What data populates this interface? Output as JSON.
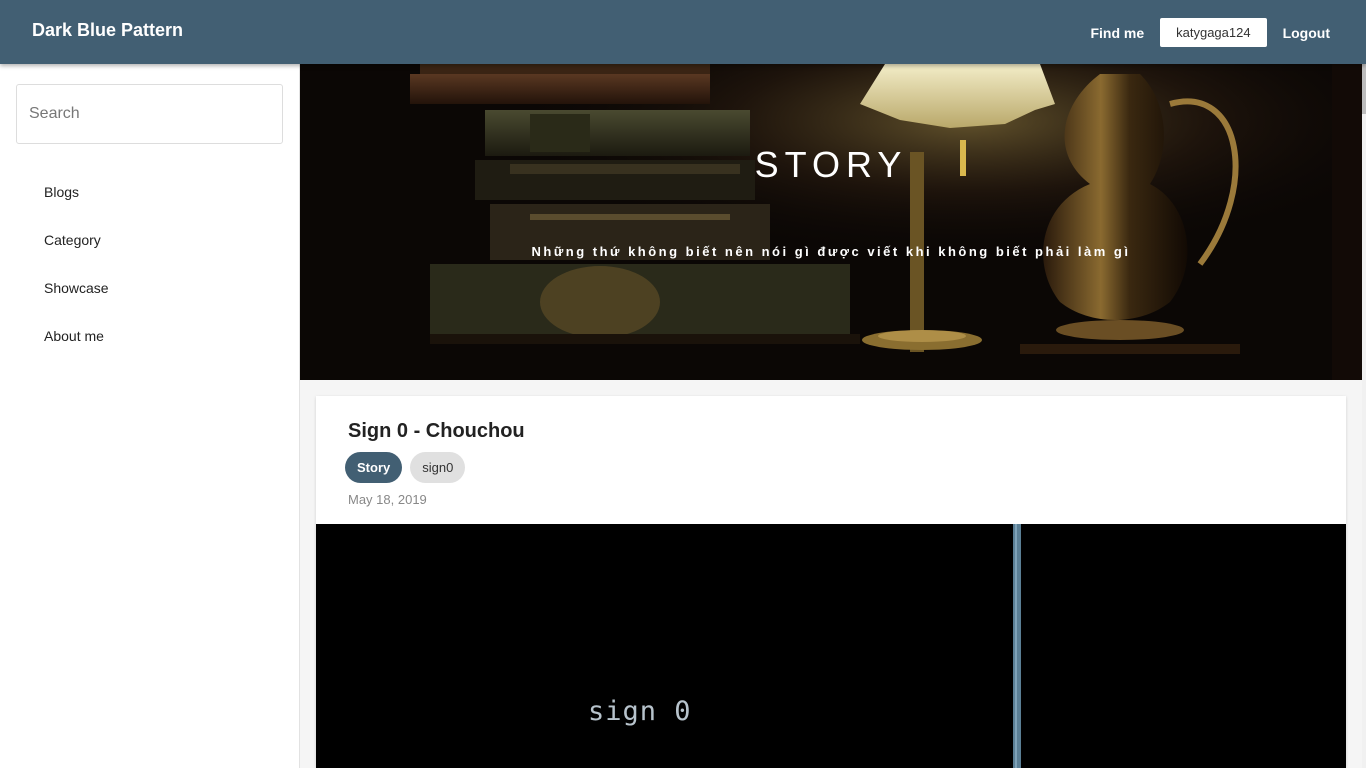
{
  "header": {
    "brand": "Dark Blue Pattern",
    "find_me": "Find me",
    "user": "katygaga124",
    "logout": "Logout",
    "color": "#425f73"
  },
  "sidebar": {
    "search_placeholder": "Search",
    "items": [
      {
        "label": "Blogs"
      },
      {
        "label": "Category"
      },
      {
        "label": "Showcase"
      },
      {
        "label": "About me"
      }
    ]
  },
  "hero": {
    "title": "STORY",
    "subtitle": "Những thứ không biết nên nói gì được viết khi không biết phải làm gì"
  },
  "post": {
    "title": "Sign 0 - Chouchou",
    "tags": [
      {
        "label": "Story"
      },
      {
        "label": "sign0"
      }
    ],
    "date": "May 18, 2019",
    "image_text": "sign 0"
  }
}
